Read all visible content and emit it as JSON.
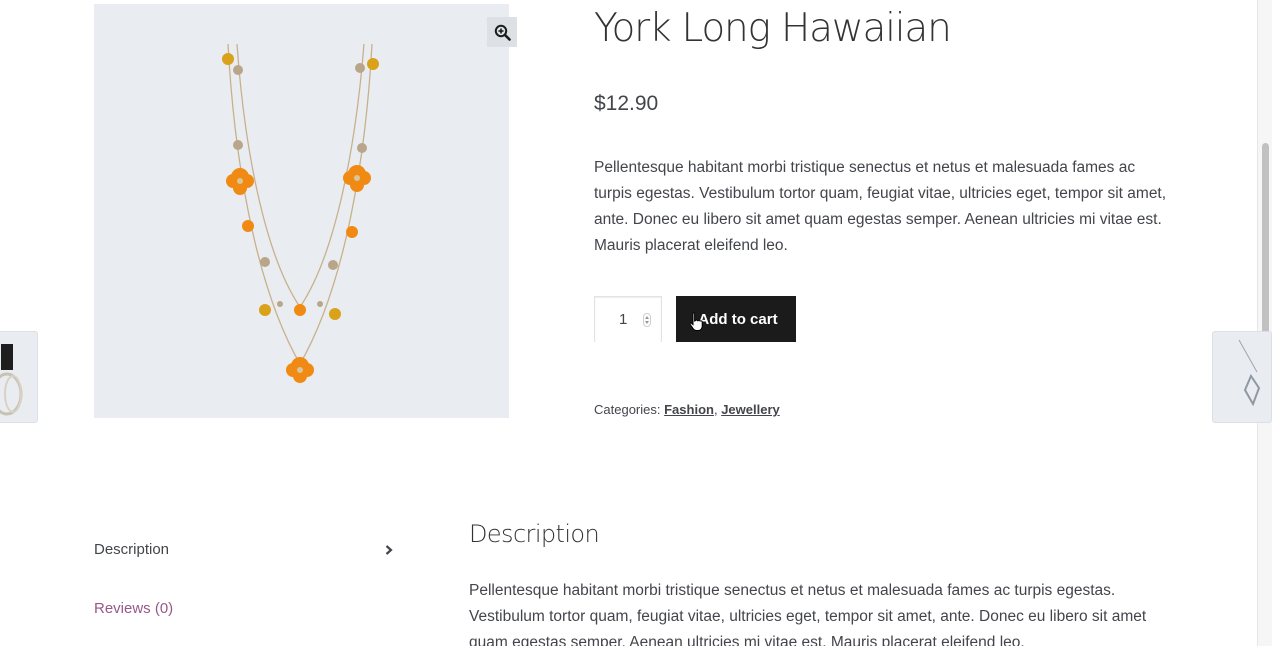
{
  "product": {
    "title": "York Long Hawaiian",
    "price": "$12.90",
    "short_description": "Pellentesque habitant morbi tristique senectus et netus et malesuada fames ac turpis egestas. Vestibulum tortor quam, feugiat vitae, ultricies eget, tempor sit amet, ante. Donec eu libero sit amet quam egestas semper. Aenean ultricies mi vitae est. Mauris placerat eleifend leo.",
    "quantity": "1",
    "add_to_cart_label": "Add to cart",
    "categories_label": "Categories:",
    "categories": [
      "Fashion",
      "Jewellery"
    ],
    "category_separator": ","
  },
  "gallery": {
    "zoom_icon": "magnifier-plus-icon"
  },
  "tabs": {
    "items": [
      {
        "label": "Description",
        "active": true
      },
      {
        "label": "Reviews (0)",
        "active": false
      }
    ],
    "panel_title": "Description",
    "panel_text": "Pellentesque habitant morbi tristique senectus et netus et malesuada fames ac turpis egestas. Vestibulum tortor quam, feugiat vitae, ultricies eget, tempor sit amet, ante. Donec eu libero sit amet quam egestas semper. Aenean ultricies mi vitae est. Mauris placerat eleifend leo."
  },
  "colors": {
    "button_bg": "#1b1b1b",
    "link_accent": "#96588a",
    "image_bg": "#e9edf1",
    "necklace_bead_orange": "#f08a12",
    "necklace_bead_amber": "#d9a21a"
  }
}
